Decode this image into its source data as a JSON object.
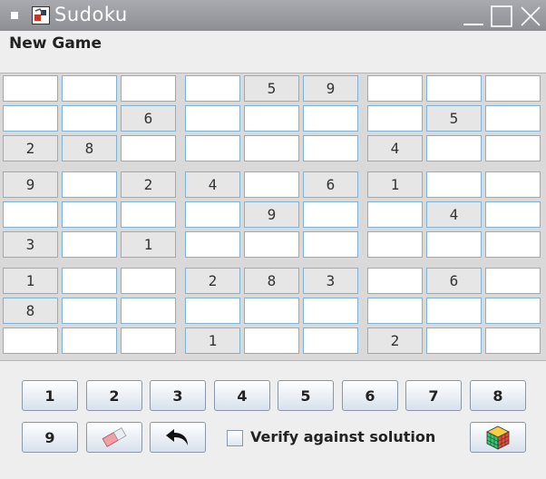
{
  "window": {
    "title": "Sudoku",
    "icons": {
      "app": "sudoku-app-icon",
      "minimize": "minimize-icon",
      "maximize": "maximize-icon",
      "close": "close-icon"
    }
  },
  "menu": {
    "new_game": "New Game"
  },
  "board": [
    [
      "",
      "",
      "",
      "",
      "5",
      "9",
      "",
      "",
      ""
    ],
    [
      "",
      "",
      "6",
      "",
      "",
      "",
      "",
      "5",
      ""
    ],
    [
      "2",
      "8",
      "",
      "",
      "",
      "",
      "4",
      "",
      ""
    ],
    [
      "9",
      "",
      "2",
      "4",
      "",
      "6",
      "1",
      "",
      ""
    ],
    [
      "",
      "",
      "",
      "",
      "9",
      "",
      "",
      "4",
      ""
    ],
    [
      "3",
      "",
      "1",
      "",
      "",
      "",
      "",
      "",
      ""
    ],
    [
      "1",
      "",
      "",
      "2",
      "8",
      "3",
      "",
      "6",
      ""
    ],
    [
      "8",
      "",
      "",
      "",
      "",
      "",
      "",
      "",
      ""
    ],
    [
      "",
      "",
      "",
      "1",
      "",
      "",
      "2",
      "",
      ""
    ]
  ],
  "colors": {
    "cell_border": "#7fb3d6",
    "given_cell": "#e6e6e6",
    "empty_cell": "#ffffff"
  },
  "keypad": {
    "digits": [
      "1",
      "2",
      "3",
      "4",
      "5",
      "6",
      "7",
      "8",
      "9"
    ],
    "erase_icon": "eraser-icon",
    "undo_icon": "undo-arrow-icon",
    "hint_icon": "rubik-cube-icon"
  },
  "verify": {
    "label": "Verify against solution",
    "checked": false
  }
}
